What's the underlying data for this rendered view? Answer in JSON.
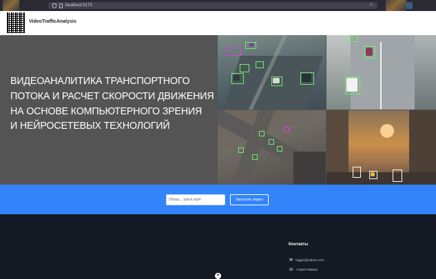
{
  "browser": {
    "url": "localhost:5173"
  },
  "header": {
    "brand": "VideoTrafficAnalysis"
  },
  "hero": {
    "title_lines": [
      "ВИДЕОАНАЛИТИКА ТРАНСПОРТНОГО",
      "ПОТОКА И РАСЧЕТ СКОРОСТИ ДВИЖЕНИЯ",
      "НА ОСНОВЕ КОМПЬЮТЕРНОГО ЗРЕНИЯ",
      "И НЕЙРОСЕТЕВЫХ ТЕХНОЛОГИЙ"
    ]
  },
  "upload": {
    "file_value": "Обзор... 1peck.mp4",
    "button_label": "Загрузить видео"
  },
  "footer": {
    "contacts_title": "Контакты",
    "email": "lrigger@yahoo.com",
    "phone": "+79237795833"
  },
  "colors": {
    "accent": "#3384fb",
    "footer_bg": "#141923",
    "hero_bg": "#545454"
  }
}
